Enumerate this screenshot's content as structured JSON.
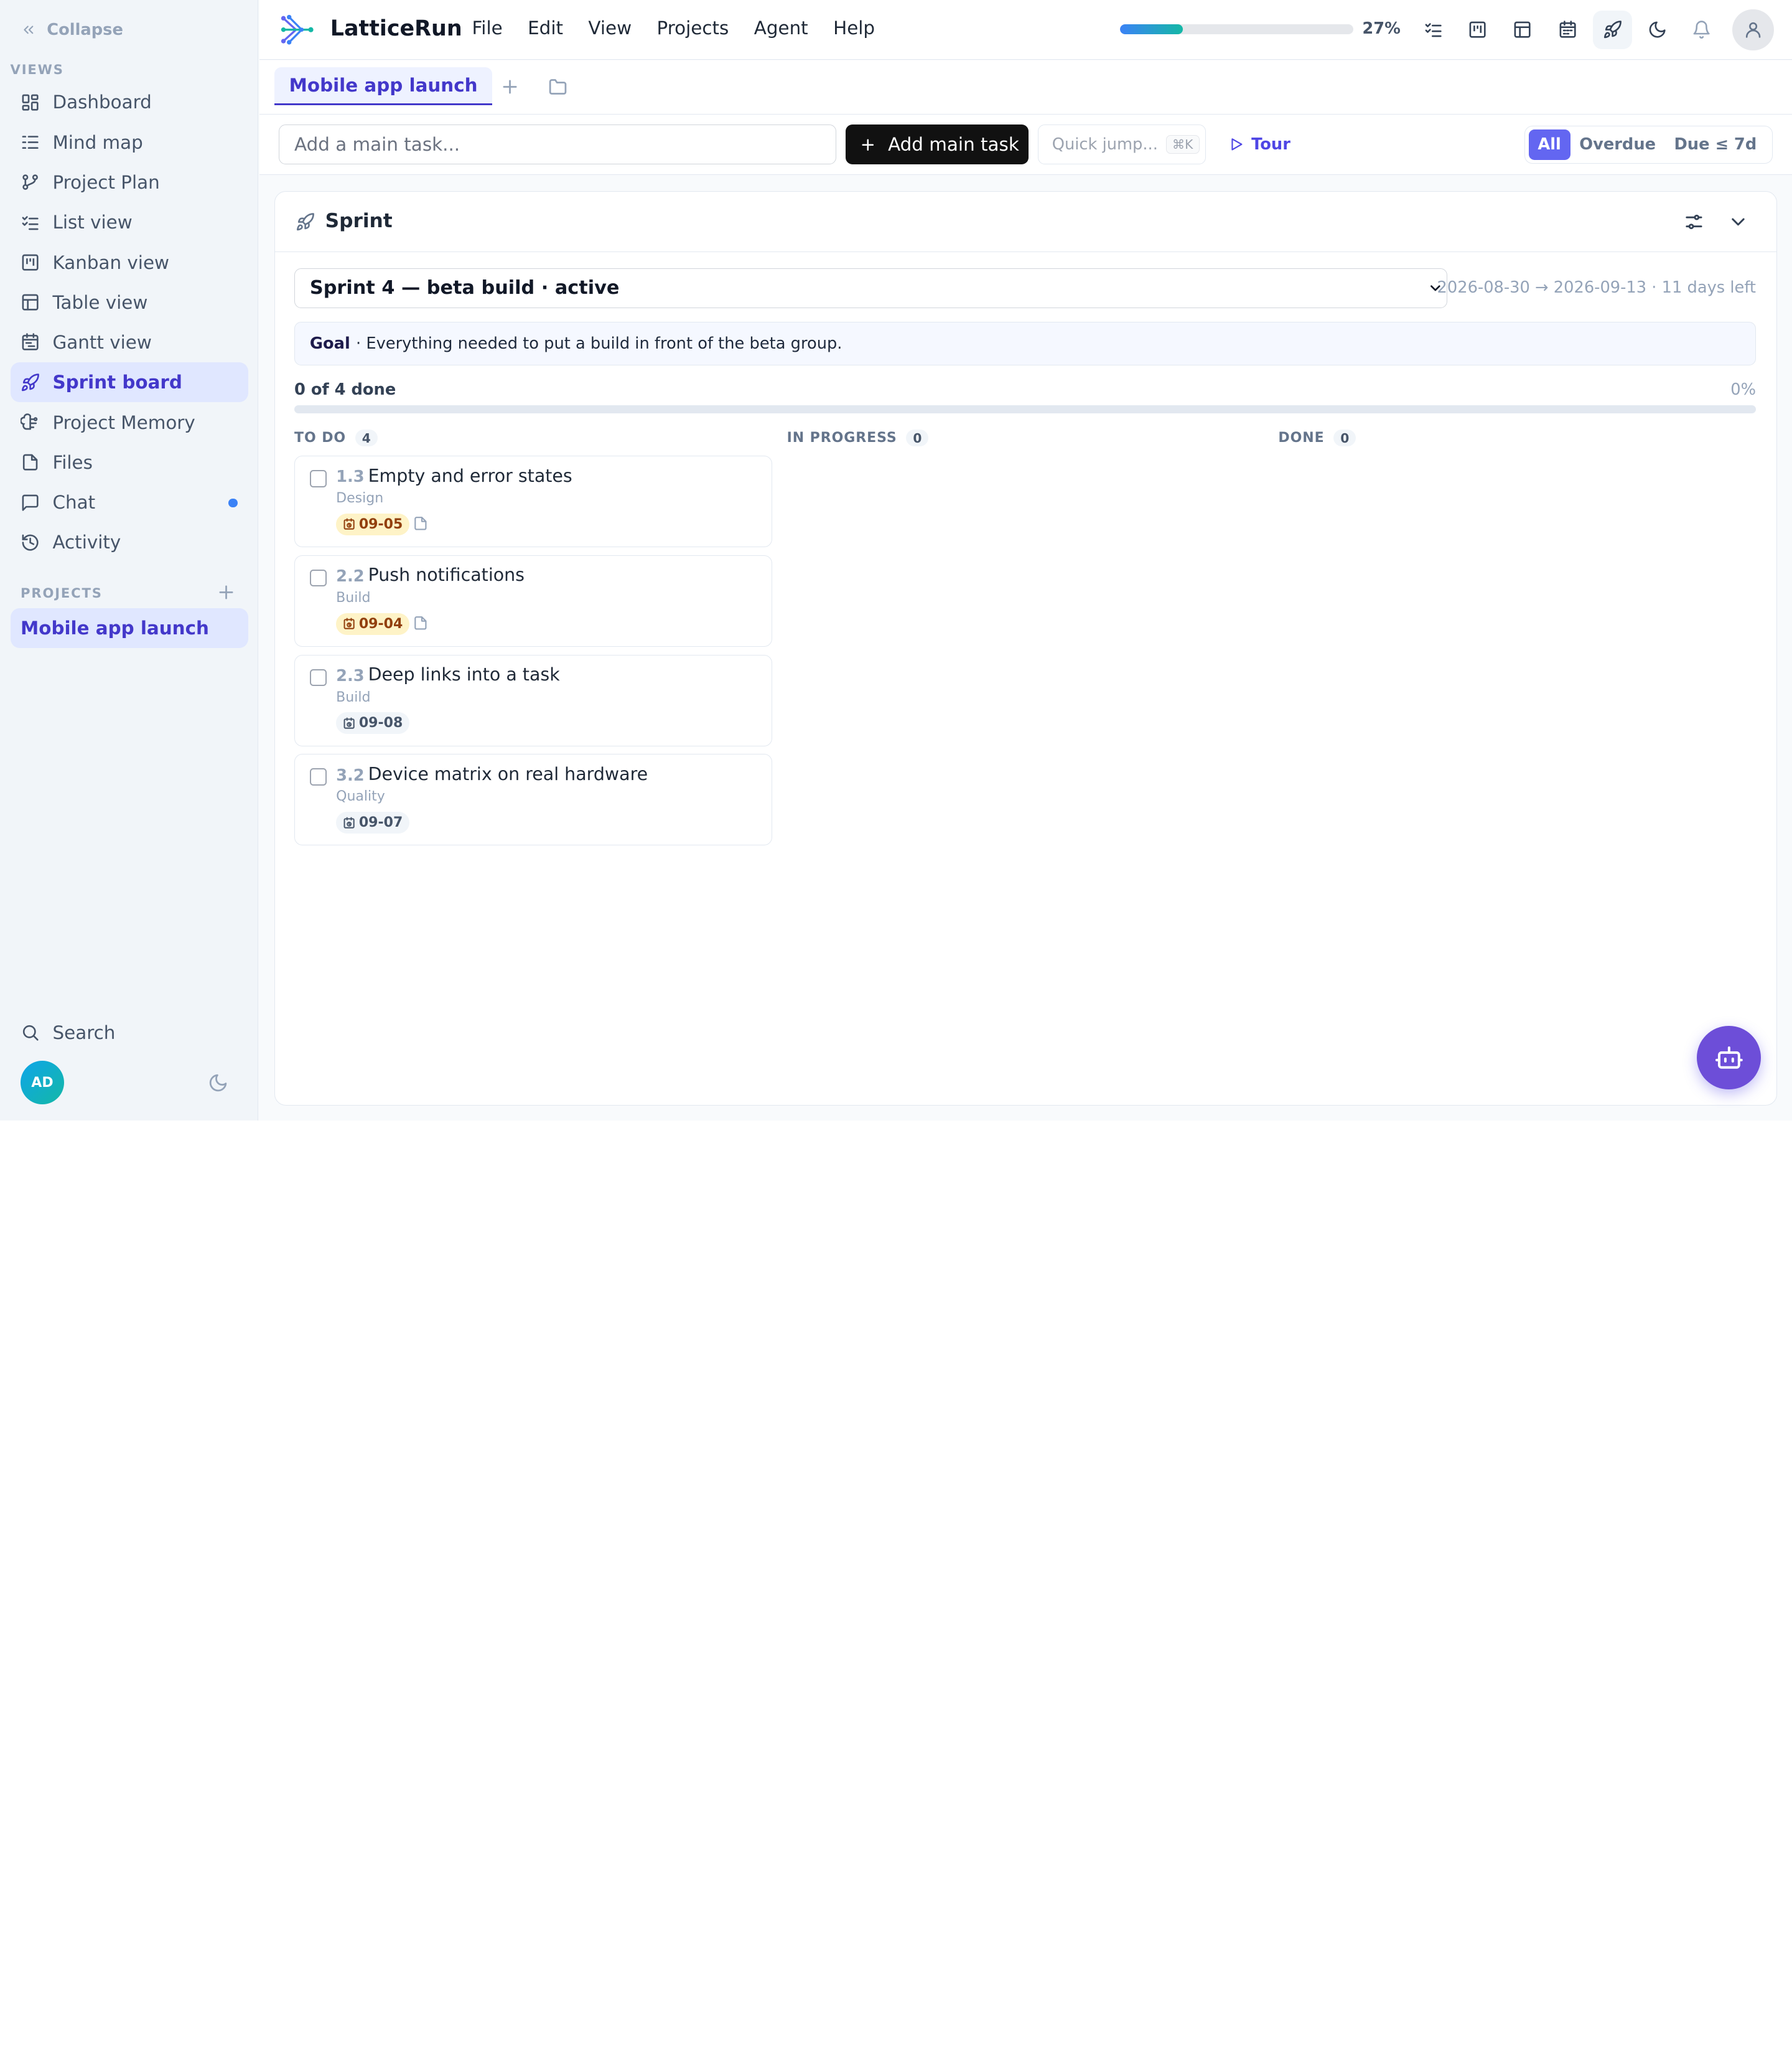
{
  "sidebar": {
    "collapse_label": "Collapse",
    "views_label": "VIEWS",
    "items": [
      {
        "label": "Dashboard",
        "icon": "dashboard-icon"
      },
      {
        "label": "Mind map",
        "icon": "mind-map-icon"
      },
      {
        "label": "Project Plan",
        "icon": "project-plan-icon"
      },
      {
        "label": "List view",
        "icon": "list-view-icon"
      },
      {
        "label": "Kanban view",
        "icon": "kanban-icon"
      },
      {
        "label": "Table view",
        "icon": "table-icon"
      },
      {
        "label": "Gantt view",
        "icon": "gantt-icon"
      },
      {
        "label": "Sprint board",
        "icon": "rocket-icon",
        "active": true
      },
      {
        "label": "Project Memory",
        "icon": "memory-icon"
      },
      {
        "label": "Files",
        "icon": "file-icon"
      },
      {
        "label": "Chat",
        "icon": "chat-icon",
        "unread_dot": true
      },
      {
        "label": "Activity",
        "icon": "history-icon"
      }
    ],
    "projects_label": "PROJECTS",
    "projects": [
      {
        "label": "Mobile app launch",
        "active": true
      }
    ],
    "search_label": "Search",
    "user_initials": "AD"
  },
  "header": {
    "app_title": "LatticeRun",
    "menu": [
      "File",
      "Edit",
      "View",
      "Projects",
      "Agent",
      "Help"
    ],
    "progress_percent": 27,
    "progress_label": "27%",
    "icons": [
      "tasks-icon",
      "kanban-icon",
      "table-icon",
      "calendar-icon",
      "rocket-icon",
      "moon-icon",
      "bell-icon",
      "user-icon"
    ],
    "active_icon": "rocket-icon"
  },
  "tabs": {
    "items": [
      {
        "label": "Mobile app launch",
        "active": true
      }
    ]
  },
  "toolbar": {
    "task_input_placeholder": "Add a main task...",
    "add_button_label": "Add main task",
    "quick_jump_label": "Quick jump...",
    "quick_jump_shortcut": "⌘K",
    "tour_label": "Tour",
    "filters": [
      {
        "label": "All",
        "active": true
      },
      {
        "label": "Overdue",
        "active": false
      },
      {
        "label": "Due ≤ 7d",
        "active": false
      }
    ]
  },
  "sprint": {
    "section_title": "Sprint",
    "selected_sprint": "Sprint 4 — beta build · active",
    "date_range": "2026-08-30 → 2026-09-13 · 11 days left",
    "goal_label": "Goal",
    "goal_text": "· Everything needed to put a build in front of the beta group.",
    "done_summary": "0 of 4 done",
    "done_percent_label": "0%",
    "done_fraction": 0,
    "columns": [
      {
        "label": "TO DO",
        "count": "4"
      },
      {
        "label": "IN PROGRESS",
        "count": "0"
      },
      {
        "label": "DONE",
        "count": "0"
      }
    ],
    "tasks": [
      {
        "id": "1.3",
        "title": "Empty and error states",
        "category": "Design",
        "due": "09-05",
        "due_status": "warn",
        "has_doc": true
      },
      {
        "id": "2.2",
        "title": "Push notifications",
        "category": "Build",
        "due": "09-04",
        "due_status": "warn",
        "has_doc": true
      },
      {
        "id": "2.3",
        "title": "Deep links into a task",
        "category": "Build",
        "due": "09-08",
        "due_status": "normal",
        "has_doc": false
      },
      {
        "id": "3.2",
        "title": "Device matrix on real hardware",
        "category": "Quality",
        "due": "09-07",
        "due_status": "normal",
        "has_doc": false
      }
    ]
  },
  "colors": {
    "accent": "#4338ca",
    "accent_light": "#e0e7ff",
    "primary_button": "#111111",
    "fab": "#6d4ed8",
    "due_warn_bg": "#fef3c7",
    "progress_start": "#3b82f6",
    "progress_end": "#14b8a6"
  }
}
